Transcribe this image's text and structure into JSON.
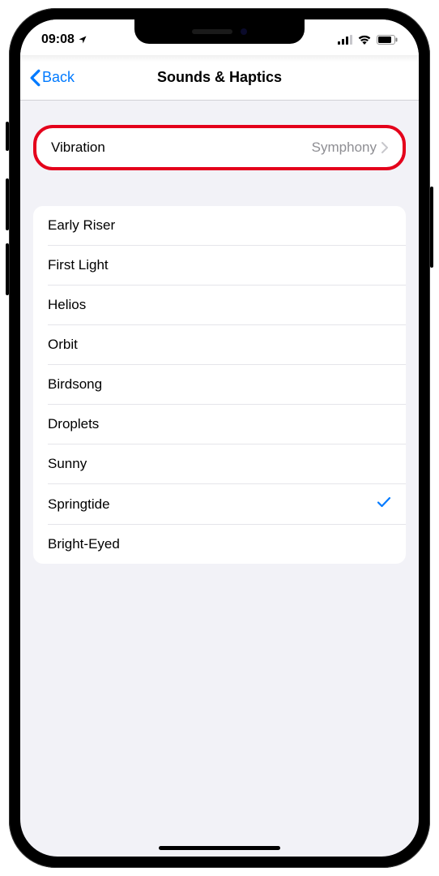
{
  "status": {
    "time": "09:08"
  },
  "nav": {
    "back_label": "Back",
    "title": "Sounds & Haptics"
  },
  "vibration": {
    "label": "Vibration",
    "value": "Symphony"
  },
  "sounds": [
    {
      "label": "Early Riser",
      "selected": false
    },
    {
      "label": "First Light",
      "selected": false
    },
    {
      "label": "Helios",
      "selected": false
    },
    {
      "label": "Orbit",
      "selected": false
    },
    {
      "label": "Birdsong",
      "selected": false
    },
    {
      "label": "Droplets",
      "selected": false
    },
    {
      "label": "Sunny",
      "selected": false
    },
    {
      "label": "Springtide",
      "selected": true
    },
    {
      "label": "Bright-Eyed",
      "selected": false
    }
  ]
}
